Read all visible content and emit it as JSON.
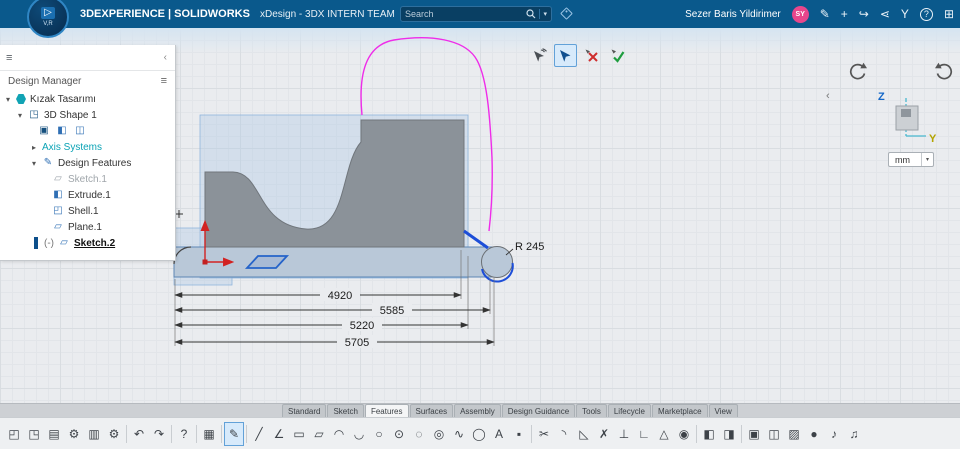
{
  "topbar": {
    "brand": "3DEXPERIENCE | SOLIDWORKS",
    "app": "xDesign - 3DX INTERN TEAM",
    "search_placeholder": "Search",
    "user": "Sezer Baris Yildirimer",
    "avatar": "SY",
    "logo": {
      "play": "▷",
      "sub": "V,R"
    },
    "icons": [
      {
        "name": "compose-icon",
        "glyph": "✎"
      },
      {
        "name": "add-icon",
        "glyph": "+"
      },
      {
        "name": "share-icon",
        "glyph": "↪"
      },
      {
        "name": "share-nodes-icon",
        "glyph": "⋖"
      },
      {
        "name": "branch-icon",
        "glyph": "Y"
      },
      {
        "name": "help-icon",
        "glyph": "?"
      },
      {
        "name": "apps-grid-icon",
        "glyph": "⊞"
      }
    ]
  },
  "panel": {
    "title": "Design Manager",
    "shape_icons": [
      {
        "name": "mini-sketch-icon",
        "glyph": "▣"
      },
      {
        "name": "mini-extrude-icon",
        "glyph": "◧"
      },
      {
        "name": "mini-pattern-icon",
        "glyph": "◫"
      }
    ],
    "tree": [
      {
        "label": "Kızak Tasarımı"
      },
      {
        "label": "3D Shape 1"
      },
      {
        "label": "Axis Systems"
      },
      {
        "label": "Design Features"
      },
      {
        "label": "Sketch.1"
      },
      {
        "label": "Extrude.1"
      },
      {
        "label": "Shell.1"
      },
      {
        "label": "Plane.1"
      },
      {
        "prefix": "(-)",
        "label": "Sketch.2"
      }
    ]
  },
  "canvas": {
    "dims": {
      "d1": "4920",
      "d2": "5585",
      "d3": "5220",
      "d4": "5705",
      "radius": "R 245"
    },
    "units": "mm",
    "axis_z": "Z",
    "axis_y": "Y"
  },
  "tabs": [
    "Standard",
    "Sketch",
    "Features",
    "Surfaces",
    "Assembly",
    "Design Guidance",
    "Tools",
    "Lifecycle",
    "Marketplace",
    "View"
  ],
  "toolbar": [
    {
      "name": "sketch-box-icon",
      "glyph": "◰"
    },
    {
      "name": "model-box-icon",
      "glyph": "◳"
    },
    {
      "name": "save-icon",
      "glyph": "▤"
    },
    {
      "name": "machine-settings-icon",
      "glyph": "⚙"
    },
    {
      "name": "print-icon",
      "glyph": "▥"
    },
    {
      "name": "preferences-gear-icon",
      "glyph": "⚙"
    },
    {
      "name": "undo-icon",
      "glyph": "↶"
    },
    {
      "name": "redo-icon",
      "glyph": "↷"
    },
    {
      "name": "help-icon",
      "glyph": "?"
    },
    {
      "name": "design-table-icon",
      "glyph": "▦"
    },
    {
      "name": "edit-sketch-icon",
      "glyph": "✎"
    },
    {
      "name": "line-icon",
      "glyph": "╱"
    },
    {
      "name": "polyline-icon",
      "glyph": "∠"
    },
    {
      "name": "rectangle-icon",
      "glyph": "▭"
    },
    {
      "name": "parallelogram-icon",
      "glyph": "▱"
    },
    {
      "name": "arc-icon",
      "glyph": "◠"
    },
    {
      "name": "tangent-arc-icon",
      "glyph": "◡"
    },
    {
      "name": "circle-icon",
      "glyph": "○"
    },
    {
      "name": "center-circle-icon",
      "glyph": "⊙"
    },
    {
      "name": "construction-circle-icon",
      "glyph": "◌"
    },
    {
      "name": "perimeter-circle-icon",
      "glyph": "◎"
    },
    {
      "name": "spline-icon",
      "glyph": "∿"
    },
    {
      "name": "ellipse-icon",
      "glyph": "◯"
    },
    {
      "name": "text-icon",
      "glyph": "A"
    },
    {
      "name": "point-icon",
      "glyph": "▪"
    },
    {
      "name": "trim-icon",
      "glyph": "✂"
    },
    {
      "name": "fillet-icon",
      "glyph": "◝"
    },
    {
      "name": "chamfer-icon",
      "glyph": "◺"
    },
    {
      "name": "delete-entity-icon",
      "glyph": "✗"
    },
    {
      "name": "constraint-icon",
      "glyph": "⊥"
    },
    {
      "name": "angle-icon",
      "glyph": "∟"
    },
    {
      "name": "polygon-icon",
      "glyph": "△"
    },
    {
      "name": "project-curve-icon",
      "glyph": "◉"
    },
    {
      "name": "extrude-icon",
      "glyph": "◧"
    },
    {
      "name": "revolve-icon",
      "glyph": "◨"
    },
    {
      "name": "primitive-cube-icon",
      "glyph": "▣"
    },
    {
      "name": "assembly-cube-icon",
      "glyph": "◫"
    },
    {
      "name": "pattern-icon",
      "glyph": "▨"
    },
    {
      "name": "sphere-icon",
      "glyph": "●"
    },
    {
      "name": "note-icon",
      "glyph": "♪"
    },
    {
      "name": "material-icon",
      "glyph": "♫"
    }
  ]
}
